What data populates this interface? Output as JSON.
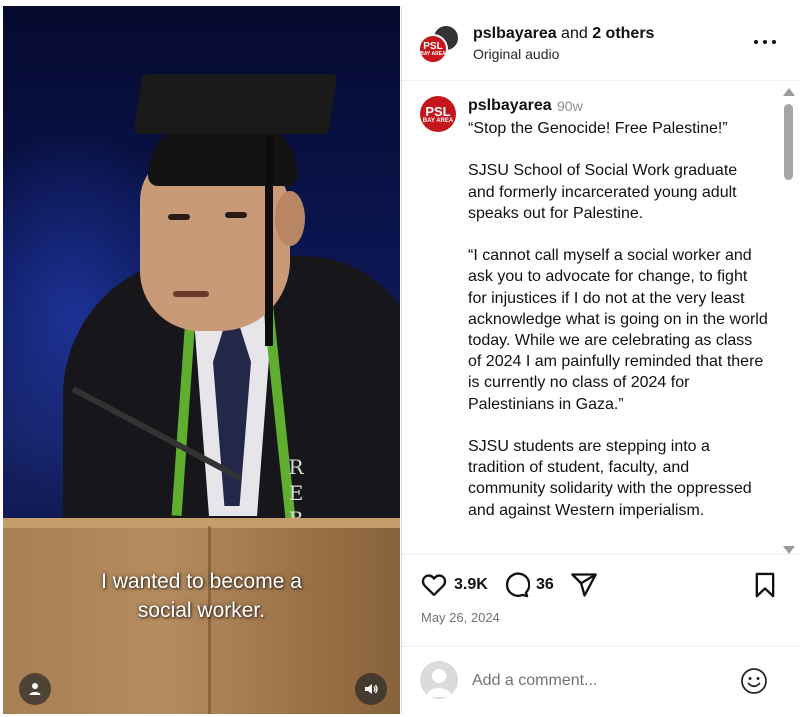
{
  "video": {
    "caption_lines": [
      "I wanted to become a",
      "social worker."
    ],
    "robe_letters": [
      "R",
      "E",
      "B"
    ]
  },
  "header": {
    "username": "pslbayarea",
    "and_text": " and ",
    "others": "2 others",
    "subtitle": "Original audio",
    "avatar_big": "PSL",
    "avatar_small": "BAY AREA"
  },
  "post": {
    "username": "pslbayarea",
    "time": "90w",
    "paragraphs": [
      "“Stop the Genocide! Free Palestine!”",
      "SJSU School of Social Work graduate and formerly incarcerated young adult speaks out for Palestine.",
      "“I cannot call myself a social worker and ask you to advocate for change, to fight for injustices if I do not at the very least acknowledge what is going on in the world today. While we are celebrating as class of 2024 I am painfully reminded that there is currently no class of 2024 for Palestinians in Gaza.”",
      "SJSU students are stepping into a tradition of student, faculty, and community solidarity with the oppressed and against Western imperialism."
    ]
  },
  "actions": {
    "likes": "3.9K",
    "comments": "36",
    "date": "May 26, 2024"
  },
  "comment": {
    "placeholder": "Add a comment..."
  },
  "colors": {
    "brand_red": "#c4161c",
    "stole_green": "#5fae2f"
  },
  "icons": [
    "heart-icon",
    "comment-icon",
    "share-icon",
    "bookmark-icon",
    "emoji-icon",
    "more-icon",
    "user-icon",
    "volume-icon"
  ]
}
